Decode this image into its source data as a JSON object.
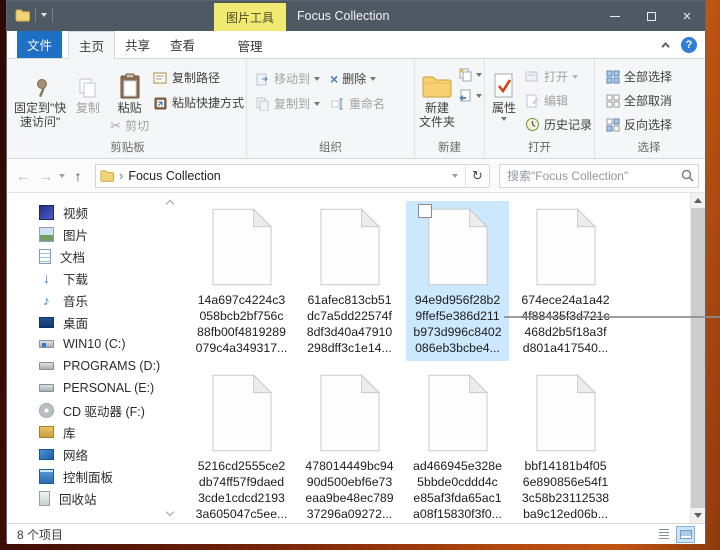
{
  "window": {
    "title": "Focus Collection",
    "tool_tab_label": "图片工具",
    "status_text": "8 个项目"
  },
  "tabs": {
    "file": "文件",
    "home": "主页",
    "share": "共享",
    "view": "查看",
    "manage": "管理"
  },
  "ribbon": {
    "pin_label": "固定到\"快\n速访问\"",
    "copy_label": "复制",
    "paste_label": "粘贴",
    "cut_label": "剪切",
    "copy_path_label": "复制路径",
    "paste_shortcut_label": "粘贴快捷方式",
    "clipboard_group": "剪贴板",
    "move_to_label": "移动到",
    "copy_to_label": "复制到",
    "delete_label": "删除",
    "rename_label": "重命名",
    "organize_group": "组织",
    "new_folder_label": "新建\n文件夹",
    "new_group": "新建",
    "properties_label": "属性",
    "open_label": "打开",
    "edit_label": "编辑",
    "history_label": "历史记录",
    "open_group": "打开",
    "select_all_label": "全部选择",
    "select_none_label": "全部取消",
    "invert_selection_label": "反向选择",
    "select_group": "选择"
  },
  "address_bar": {
    "path": "Focus Collection",
    "search_placeholder": "搜索\"Focus Collection\""
  },
  "sidebar": {
    "items": [
      {
        "label": "视频"
      },
      {
        "label": "图片"
      },
      {
        "label": "文档"
      },
      {
        "label": "下载"
      },
      {
        "label": "音乐"
      },
      {
        "label": "桌面"
      },
      {
        "label": "WIN10 (C:)"
      },
      {
        "label": "PROGRAMS (D:)"
      },
      {
        "label": "PERSONAL (E:)"
      },
      {
        "label": "CD 驱动器 (F:)"
      },
      {
        "label": "库"
      },
      {
        "label": "网络"
      },
      {
        "label": "控制面板"
      },
      {
        "label": "回收站"
      }
    ]
  },
  "files": [
    {
      "selected": false,
      "lines": [
        "14a697c4224c3",
        "058bcb2bf756c",
        "88fb00f4819289",
        "079c4a349317..."
      ]
    },
    {
      "selected": false,
      "lines": [
        "61afec813cb51",
        "dc7a5dd22574f",
        "8df3d40a47910",
        "298dff3c1e14..."
      ]
    },
    {
      "selected": true,
      "lines": [
        "94e9d956f28b2",
        "9ffef5e386d211",
        "b973d996c8402",
        "086eb3bcbe4..."
      ]
    },
    {
      "selected": false,
      "lines": [
        "674ece24a1a42",
        "4f88435f3d721c",
        "468d2b5f18a3f",
        "d801a417540..."
      ]
    },
    {
      "selected": false,
      "lines": [
        "5216cd2555ce2",
        "db74ff57f9daed",
        "3cde1cdcd2193",
        "3a605047c5ee..."
      ]
    },
    {
      "selected": false,
      "lines": [
        "478014449bc94",
        "90d500ebf6e73",
        "eaa9be48ec789",
        "37296a09272..."
      ]
    },
    {
      "selected": false,
      "lines": [
        "ad466945e328e",
        "5bbde0cddd4c",
        "e85af3fda65ac1",
        "a08f15830f3f0..."
      ]
    },
    {
      "selected": false,
      "lines": [
        "bbf14181b4f05",
        "6e890856e54f1",
        "3c58b23112538",
        "ba9c12ed06b..."
      ]
    }
  ],
  "icons": {
    "back": "←",
    "forward": "→",
    "up": "↑",
    "refresh": "↻",
    "breadcrumb_sep": "›",
    "cut": "✂",
    "delete_x": "×",
    "close": "×",
    "help": "?",
    "music_note": "♪",
    "download_arrow": "↓"
  },
  "colors": {
    "titlebar": "#4f5963",
    "file_tab_blue": "#1d70c3",
    "tool_tab_yellow": "#f0ea72",
    "selection_blue": "#cce8ff"
  }
}
